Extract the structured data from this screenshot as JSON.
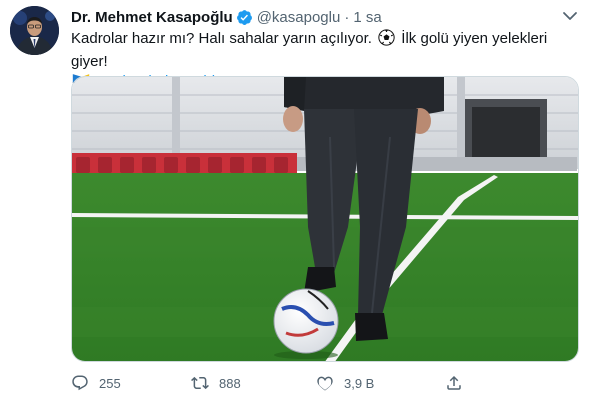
{
  "tweet": {
    "author_name": "Dr. Mehmet Kasapoğlu",
    "handle": "@kasapoglu",
    "separator": "·",
    "time": "1 sa",
    "text_part1": "Kadrolar hazır mı? Halı sahalar yarın açılıyor. ",
    "text_part2": " İlk golü yiyen yelekleri giyer!",
    "hashtag": "#HalıSahalarAçıldı",
    "icons": {
      "verified": "verified-badge-icon",
      "more": "chevron-down-icon",
      "ball": "soccer-ball-emoji",
      "flag": "flag-emoji"
    },
    "colors": {
      "link": "#1d9bf0",
      "secondary_text": "#536471",
      "pitch_green": "#3f8f2f",
      "stand_red": "#c9303a"
    }
  },
  "actions": {
    "reply_count": "255",
    "retweet_count": "888",
    "like_count": "3,9 B"
  }
}
